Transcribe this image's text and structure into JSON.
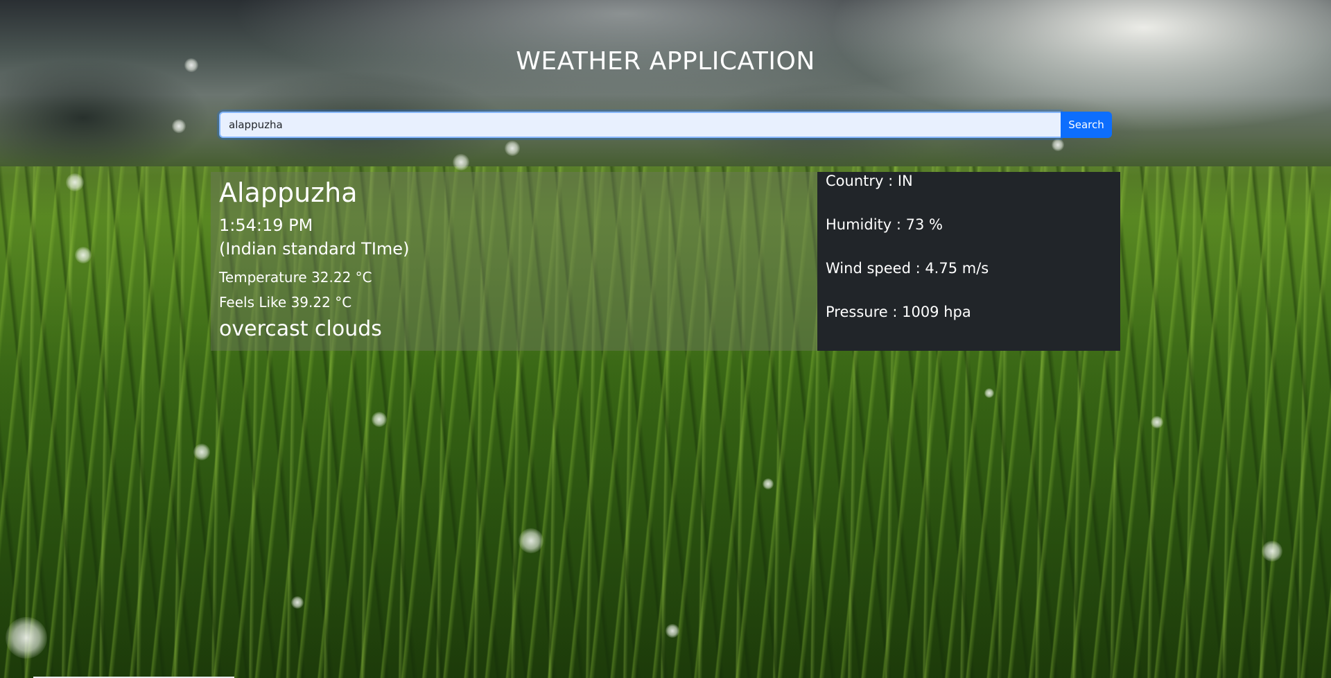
{
  "header": {
    "title": "WEATHER APPLICATION"
  },
  "search": {
    "value": "alappuzha",
    "button_label": "Search"
  },
  "weather": {
    "city": "Alappuzha",
    "time": "1:54:19 PM",
    "timezone": "(Indian standard TIme)",
    "temperature": "Temperature 32.22 °C",
    "feels_like": "Feels Like 39.22 °C",
    "description": "overcast clouds"
  },
  "details": {
    "country": "Country : IN",
    "humidity": "Humidity : 73 %",
    "wind_speed": "Wind speed : 4.75 m/s",
    "pressure": "Pressure : 1009 hpa"
  },
  "colors": {
    "search_button": "#0d6efd",
    "details_panel": "#212529",
    "input_background": "#e8f0fe"
  }
}
